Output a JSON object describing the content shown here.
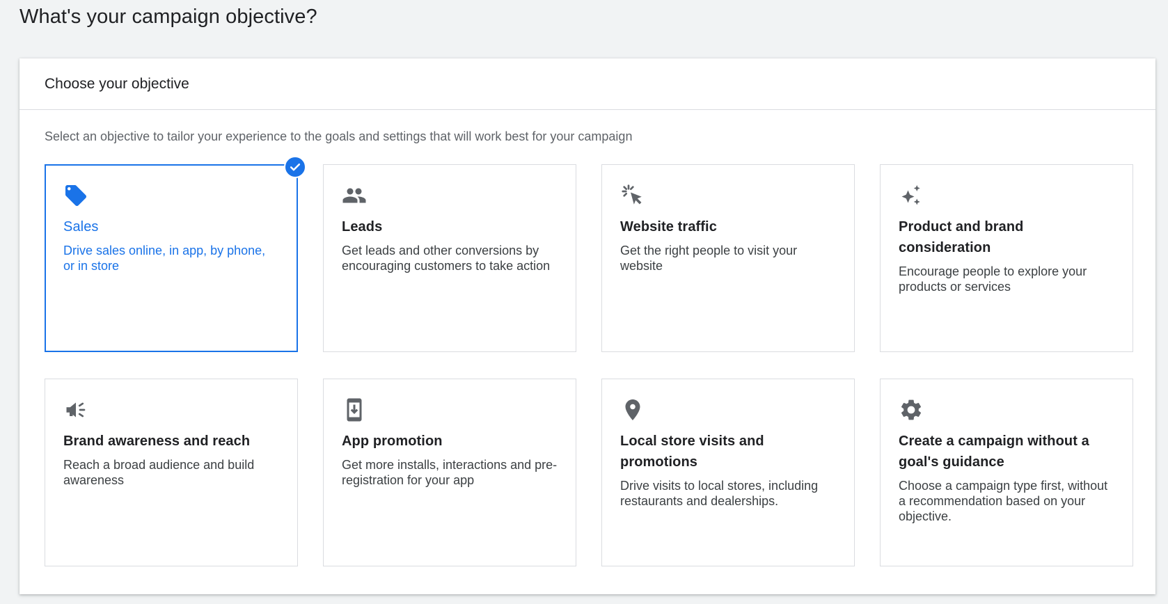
{
  "page": {
    "title": "What's your campaign objective?"
  },
  "panel": {
    "header": "Choose your objective",
    "subtitle": "Select an objective to tailor your experience to the goals and settings that will work best for your campaign"
  },
  "objectives": [
    {
      "icon": "tag-icon",
      "title": "Sales",
      "description": "Drive sales online, in app, by phone, or in store",
      "selected": true
    },
    {
      "icon": "people-icon",
      "title": "Leads",
      "description": "Get leads and other conversions by encouraging customers to take action",
      "selected": false
    },
    {
      "icon": "cursor-click-icon",
      "title": "Website traffic",
      "description": "Get the right people to visit your website",
      "selected": false
    },
    {
      "icon": "sparkle-icon",
      "title": "Product and brand consideration",
      "description": "Encourage people to explore your products or services",
      "selected": false
    },
    {
      "icon": "megaphone-icon",
      "title": "Brand awareness and reach",
      "description": "Reach a broad audience and build awareness",
      "selected": false
    },
    {
      "icon": "phone-download-icon",
      "title": "App promotion",
      "description": "Get more installs, interactions and pre-registration for your app",
      "selected": false
    },
    {
      "icon": "location-pin-icon",
      "title": "Local store visits and promotions",
      "description": "Drive visits to local stores, including restaurants and dealerships.",
      "selected": false
    },
    {
      "icon": "gear-icon",
      "title": "Create a campaign without a goal's guidance",
      "description": "Choose a campaign type first, without a recommendation based on your objective.",
      "selected": false
    }
  ],
  "colors": {
    "accent": "#1a73e8",
    "icon": "#5f6368",
    "border": "#dadce0"
  }
}
